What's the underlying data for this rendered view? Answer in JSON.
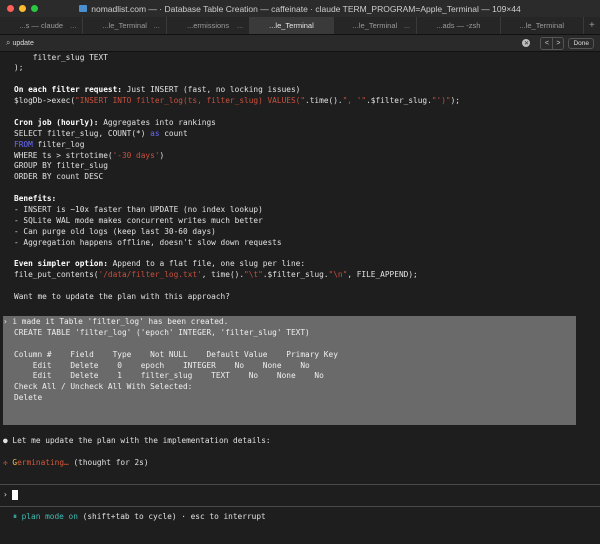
{
  "window": {
    "title": "nomadlist.com — · Database Table Creation — caffeinate · claude TERM_PROGRAM=Apple_Terminal — 109×44"
  },
  "tabs": [
    {
      "label": "...s — claude",
      "more": "..."
    },
    {
      "label": "...le_Terminal",
      "more": "..."
    },
    {
      "label": "...ermissions",
      "more": "..."
    },
    {
      "label": "...le_Terminal",
      "active": true
    },
    {
      "label": "...le_Terminal",
      "more": "..."
    },
    {
      "label": "...ads — -zsh"
    },
    {
      "label": "...le_Terminal"
    }
  ],
  "tab_plus": "+",
  "search": {
    "query": "update",
    "done": "Done",
    "prev": "<",
    "next": ">"
  },
  "lines": [
    [
      {
        "t": "    filter_slug TEXT"
      }
    ],
    [
      {
        "t": ");"
      }
    ],
    [],
    [
      {
        "t": "On each filter request:",
        "c": "b"
      },
      {
        "t": " Just INSERT (fast, no locking issues)"
      }
    ],
    [
      {
        "t": "$logDb->exec("
      },
      {
        "t": "\"INSERT INTO filter_log(ts, filter_slug) VALUES(\"",
        "c": "s"
      },
      {
        "t": ".time()."
      },
      {
        "t": "\", '\"",
        "c": "s"
      },
      {
        "t": ".$filter_slug."
      },
      {
        "t": "\"')\"",
        "c": "s"
      },
      {
        "t": ");"
      }
    ],
    [],
    [
      {
        "t": "Cron job (hourly):",
        "c": "b"
      },
      {
        "t": " Aggregates into rankings"
      }
    ],
    [
      {
        "t": "SELECT filter_slug, COUNT(*) "
      },
      {
        "t": "as",
        "c": "k"
      },
      {
        "t": " count"
      }
    ],
    [
      {
        "t": "FROM",
        "c": "k"
      },
      {
        "t": " filter_log"
      }
    ],
    [
      {
        "t": "WHERE ts > strtotime("
      },
      {
        "t": "'-30 days'",
        "c": "s"
      },
      {
        "t": ")"
      }
    ],
    [
      {
        "t": "GROUP BY filter_slug"
      }
    ],
    [
      {
        "t": "ORDER BY count DESC"
      }
    ],
    [],
    [
      {
        "t": "Benefits:",
        "c": "b"
      }
    ],
    [
      {
        "t": "- INSERT is ~10x faster than UPDATE (no index lookup)"
      }
    ],
    [
      {
        "t": "- SQLite WAL mode makes concurrent writes much better"
      }
    ],
    [
      {
        "t": "- Can purge old logs (keep last 30-60 days)"
      }
    ],
    [
      {
        "t": "- Aggregation happens offline, doesn't slow down requests"
      }
    ],
    [],
    [
      {
        "t": "Even simpler option:",
        "c": "b"
      },
      {
        "t": " Append to a flat file, one slug per line:"
      }
    ],
    [
      {
        "t": "file_put_contents("
      },
      {
        "t": "'/data/filter_log.txt'",
        "c": "s"
      },
      {
        "t": ", time()."
      },
      {
        "t": "\"\\t\"",
        "c": "s"
      },
      {
        "t": ".$filter_slug."
      },
      {
        "t": "\"\\n\"",
        "c": "s"
      },
      {
        "t": ", FILE_APPEND);"
      }
    ],
    [],
    [
      {
        "t": "Want me to update the plan with this approach?"
      }
    ]
  ],
  "user_message": [
    "› i made it Table 'filter_log' has been created.",
    "CREATE TABLE 'filter_log' ('epoch' INTEGER, 'filter_slug' TEXT)",
    "",
    "Column #    Field    Type    Not NULL    Default Value    Primary Key",
    "    Edit    Delete    0    epoch    INTEGER    No    None    No",
    "    Edit    Delete    1    filter_slug    TEXT    No    None    No",
    "Check All / Uncheck All With Selected:",
    "Delete"
  ],
  "assistant": {
    "bullet": "●",
    "text": "Let me update the plan with the implementation details:"
  },
  "status": {
    "icon": "✢",
    "first": "G",
    "rest": "erminating…",
    "detail": " (thought for 2s)"
  },
  "prompt": {
    "symbol": "›"
  },
  "footer": {
    "icon": "⏸",
    "mode": "plan mode on",
    "hint": " (shift+tab to cycle) · esc to interrupt"
  }
}
